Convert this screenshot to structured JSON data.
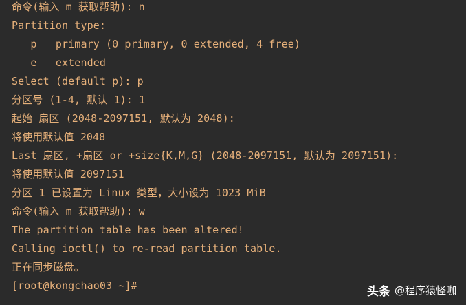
{
  "terminal": {
    "text_color": "#e6b07a",
    "background_color": "#2b2b2b",
    "lines": [
      "命令(输入 m 获取帮助): n",
      "Partition type:",
      "   p   primary (0 primary, 0 extended, 4 free)",
      "   e   extended",
      "Select (default p): p",
      "分区号 (1-4, 默认 1): 1",
      "起始 扇区 (2048-2097151, 默认为 2048):",
      "将使用默认值 2048",
      "Last 扇区, +扇区 or +size{K,M,G} (2048-2097151, 默认为 2097151):",
      "将使用默认值 2097151",
      "分区 1 已设置为 Linux 类型，大小设为 1023 MiB",
      "命令(输入 m 获取帮助): w",
      "The partition table has been altered!",
      "Calling ioctl() to re-read partition table.",
      "正在同步磁盘。",
      "[root@kongchao03 ~]#"
    ]
  },
  "watermark": {
    "brand": "头条",
    "author": "@程序猿怪咖"
  }
}
